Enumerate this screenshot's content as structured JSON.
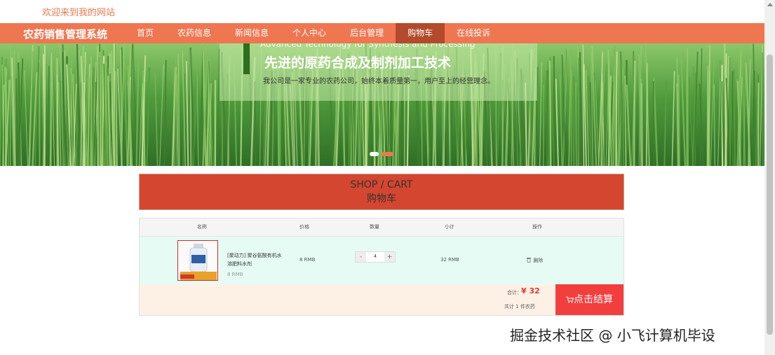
{
  "header": {
    "welcome": "欢迎来到我的网站"
  },
  "nav": {
    "brand": "农药销售管理系统",
    "items": [
      "首页",
      "农药信息",
      "新闻信息",
      "个人中心",
      "后台管理",
      "购物车",
      "在线投诉"
    ],
    "active": "购物车"
  },
  "banner": {
    "subtitle": "Advanced Technology for Synthesis and Processing",
    "title": "先进的原药合成及制剂加工技术",
    "description": "我公司是一家专业的农药公司，始终本着质量第一，用户至上的经营理念。"
  },
  "shop": {
    "title_en": "SHOP / CART",
    "title_zh": "购物车"
  },
  "cart": {
    "headers": {
      "name": "名称",
      "price": "价格",
      "qty": "数量",
      "subtotal": "小计",
      "ops": "操作"
    },
    "item": {
      "name": "[聚动力] 聚谷氨酸有机水溶肥料水剂",
      "unit_price": "8 RMB",
      "price": "8 RMB",
      "qty": "4",
      "subtotal": "32 RMB",
      "delete": "删除",
      "minus": "-",
      "plus": "+"
    },
    "footer": {
      "total_label": "合计：",
      "total_value": "¥ 32",
      "count_label": "共计 1 件农药",
      "checkout": "点击结算"
    }
  },
  "watermark": "掘金技术社区 @ 小飞计算机毕设",
  "colors": {
    "nav": "#ee7752",
    "nav_active": "#b44a2c",
    "shop_head": "#d4462f",
    "checkout": "#f33e3e"
  }
}
